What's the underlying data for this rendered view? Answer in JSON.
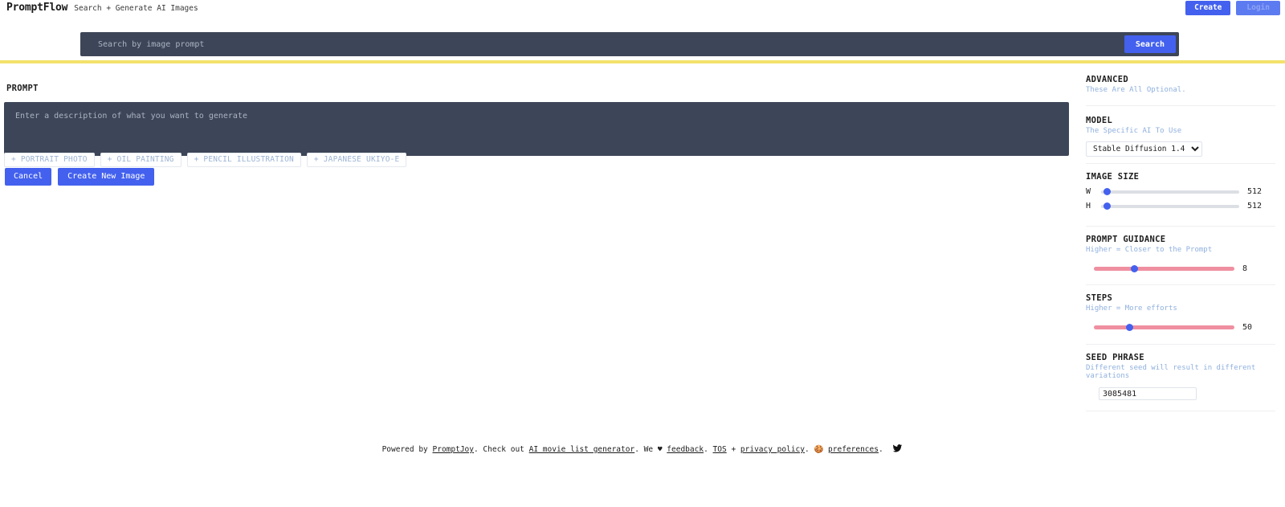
{
  "header": {
    "brand": "PromptFlow",
    "tagline": "Search + Generate AI Images",
    "create_label": "Create",
    "login_label": "Login"
  },
  "search": {
    "placeholder": "Search by image prompt",
    "value": "",
    "button_label": "Search"
  },
  "prompt": {
    "section_label": "PROMPT",
    "placeholder": "Enter a description of what you want to generate",
    "value": "",
    "chips": [
      "+ PORTRAIT PHOTO",
      "+ OIL PAINTING",
      "+ PENCIL ILLUSTRATION",
      "+ JAPANESE UKIYO-E"
    ],
    "cancel_label": "Cancel",
    "create_label": "Create New Image"
  },
  "sidebar": {
    "advanced": {
      "title": "ADVANCED",
      "subtitle": "These Are All Optional."
    },
    "model": {
      "title": "MODEL",
      "subtitle": "The Specific AI To Use",
      "selected": "Stable Diffusion 1.4",
      "options": [
        "Stable Diffusion 1.4"
      ]
    },
    "image_size": {
      "title": "IMAGE SIZE",
      "width_key": "W",
      "width_value": "512",
      "width_pct": 2,
      "height_key": "H",
      "height_value": "512",
      "height_pct": 2
    },
    "guidance": {
      "title": "PROMPT GUIDANCE",
      "subtitle": "Higher = Closer to the Prompt",
      "value": "8",
      "pct": 28
    },
    "steps": {
      "title": "STEPS",
      "subtitle": "Higher = More efforts",
      "value": "50",
      "pct": 24
    },
    "seed": {
      "title": "SEED PHRASE",
      "subtitle": "Different seed will result in different variations",
      "value": "3085481"
    }
  },
  "footer": {
    "powered_by": "Powered by",
    "promptjoy": "PromptJoy",
    "check_out": ". Check out",
    "movie_link": "AI movie list generator",
    "we_love": ". We",
    "heart": "♥",
    "feedback": "feedback",
    "dot1": ".",
    "tos": "TOS",
    "plus": "+",
    "privacy": "privacy policy",
    "dot2": ".",
    "cookie": "🍪",
    "preferences": "preferences",
    "dot3": ".",
    "twitter_icon": "twitter-bird-icon"
  },
  "colors": {
    "accent_blue": "#4361ee",
    "dark_panel": "#3d4658",
    "yellow_bar": "#f2e26a",
    "pink_track": "#ef8fa0",
    "link_blue": "#8fb0de"
  }
}
